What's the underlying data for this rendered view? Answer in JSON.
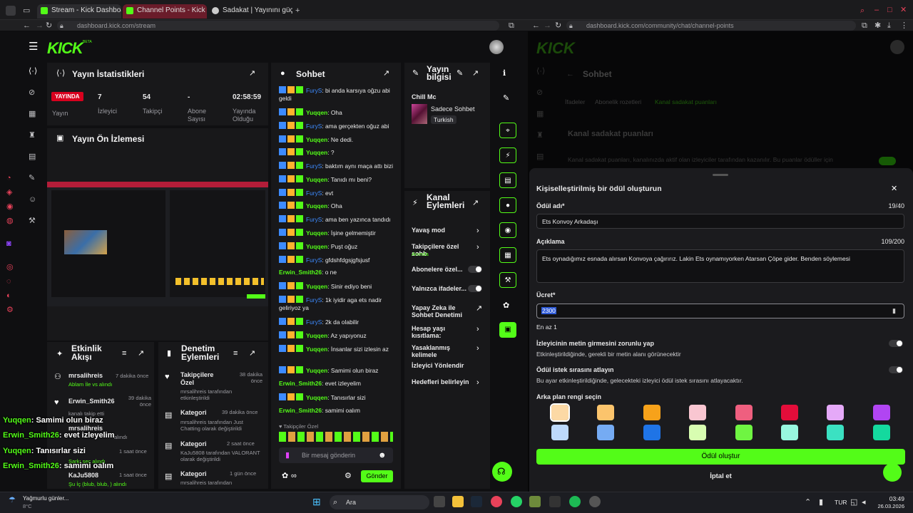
{
  "browser": {
    "tabs": [
      "Stream - Kick Dashboard",
      "Channel Points - Kick Das",
      "Sadakat | Yayınını güçlend"
    ],
    "url_left": "dashboard.kick.com/stream",
    "url_right": "dashboard.kick.com/community/chat/channel-points"
  },
  "logo": "KICK",
  "logo_beta": "BETA",
  "stats": {
    "title": "Yayın İstatistikleri",
    "live_badge": "YAYINDA",
    "live_label": "Yayın",
    "viewers": "7",
    "viewers_label": "İzleyici",
    "followers": "54",
    "followers_label": "Takipçi",
    "subs": "-",
    "subs_label": "Abone Sayısı",
    "duration": "02:58:59",
    "duration_label": "Yayında Olduğu"
  },
  "preview": {
    "title": "Yayın Ön İzlemesi"
  },
  "activity": {
    "title": "Etkinlik Akışı",
    "items": [
      {
        "user": "mrsalihreis",
        "time": "7 dakika önce",
        "detail": "Ablam İle vs alındı"
      },
      {
        "user": "Erwin_Smith26",
        "time": "39 dakika önce",
        "detail": "kanalı takip etti"
      },
      {
        "user": "mrsalihreis",
        "time": "",
        "detail": "alındı"
      },
      {
        "user": "",
        "time": "1 saat önce",
        "detail": "Şarkı seç alındı"
      },
      {
        "user": "KaJu5808",
        "time": "1 saat önce",
        "detail": "Şu İç (blub, blub, ) alındı"
      }
    ]
  },
  "moderation": {
    "title": "Denetim Eylemleri",
    "items": [
      {
        "title": "Takipçilere Özel",
        "time": "38 dakika önce",
        "detail": "mrsalihreis tarafından etkinleştirildi"
      },
      {
        "title": "Kategori",
        "time": "39 dakika önce",
        "detail": "mrsalihreis tarafından Just Chatting olarak değiştirildi"
      },
      {
        "title": "Kategori",
        "time": "2 saat önce",
        "detail": "KaJu5808 tarafından VALORANT olarak değiştirildi"
      },
      {
        "title": "Kategori",
        "time": "1 gün önce",
        "detail": "mrsalihreis tarafından"
      }
    ]
  },
  "chat": {
    "title": "Sohbet",
    "messages": [
      {
        "user": "FuryS",
        "text": ": bi anda karsıya oğzu abi geldi",
        "cls": "user-blue",
        "badges": true
      },
      {
        "user": "Yuqqen",
        "text": ": Oha",
        "cls": "user-green",
        "badges": true
      },
      {
        "user": "FuryS",
        "text": ": ama gerçekten oğuz abi",
        "cls": "user-blue",
        "badges": true
      },
      {
        "user": "Yuqqen",
        "text": ": Ne dedi.",
        "cls": "user-green",
        "badges": true
      },
      {
        "user": "Yuqqen",
        "text": ": ?",
        "cls": "user-green",
        "badges": true
      },
      {
        "user": "FuryS",
        "text": ": baktım aynı maça attı bizi",
        "cls": "user-blue",
        "badges": true
      },
      {
        "user": "Yuqqen",
        "text": ": Tanıdı mı beni?",
        "cls": "user-green",
        "badges": true
      },
      {
        "user": "FuryS",
        "text": ": evt",
        "cls": "user-blue",
        "badges": true
      },
      {
        "user": "Yuqqen",
        "text": ": Oha",
        "cls": "user-green",
        "badges": true
      },
      {
        "user": "FuryS",
        "text": ": ama ben yazınca tandıdı",
        "cls": "user-blue",
        "badges": true
      },
      {
        "user": "Yuqqen",
        "text": ": İşine gelmemiştir",
        "cls": "user-green",
        "badges": true
      },
      {
        "user": "Yuqqen",
        "text": ": Puşt oğuz",
        "cls": "user-green",
        "badges": true
      },
      {
        "user": "FuryS",
        "text": ": gfdshfdgsjgfsjusf",
        "cls": "user-blue",
        "badges": true
      },
      {
        "user": "Erwin_Smith26",
        "text": ": o ne",
        "cls": "user-green",
        "badges": false
      },
      {
        "user": "Yuqqen",
        "text": ": Sinir ediyo beni",
        "cls": "user-green",
        "badges": true
      },
      {
        "user": "FuryS",
        "text": ": 1k iyidir aga ets nadir geliriyoz ya",
        "cls": "user-blue",
        "badges": true
      },
      {
        "user": "FuryS",
        "text": ": 2k da olabilir",
        "cls": "user-blue",
        "badges": true
      },
      {
        "user": "Yuqqen",
        "text": ": Az yapıyonuz",
        "cls": "user-green",
        "badges": true
      },
      {
        "user": "Yuqqen",
        "text": ": İnsanlar sizi izlesin az",
        "cls": "user-green",
        "badges": true
      },
      {
        "user": "Yuqqen",
        "text": ": Samimi olun biraz",
        "cls": "user-green",
        "badges": true
      },
      {
        "user": "Erwin_Smith26",
        "text": ": evet izleyelim",
        "cls": "user-green",
        "badges": false
      },
      {
        "user": "Yuqqen",
        "text": ": Tanısırlar sizi",
        "cls": "user-green",
        "badges": true
      },
      {
        "user": "Erwin_Smith26",
        "text": ": samimi oalım",
        "cls": "user-green",
        "badges": false
      }
    ],
    "followers_only": "Takipçiler Özel",
    "input_placeholder": "Bir mesaj gönderin",
    "send": "Gönder"
  },
  "stream_info": {
    "title": "Yayın bilgisi",
    "stream_title": "Chill Mc",
    "category": "Sadece Sohbet",
    "language": "Turkish"
  },
  "channel_actions": {
    "title": "Kanal Eylemleri",
    "items": [
      {
        "label": "Yavaş mod",
        "sub": "",
        "kind": "arrow"
      },
      {
        "label": "Takipçilere özel sohb",
        "sub": "Anında",
        "kind": "arrow"
      },
      {
        "label": "Abonelere özel...",
        "sub": "",
        "kind": "toggle"
      },
      {
        "label": "Yalnızca ifadeler...",
        "sub": "",
        "kind": "toggle"
      },
      {
        "label": "Yapay Zeka ile Sohbet Denetimi",
        "sub": "",
        "kind": "ext"
      },
      {
        "label": "Hesap yaşı kısıtlama:",
        "sub": "",
        "kind": "arrow"
      },
      {
        "label": "Yasaklanmış kelimele",
        "sub": "",
        "kind": "arrow"
      },
      {
        "label": "İzleyici Yönlendir",
        "sub": "",
        "kind": "none"
      },
      {
        "label": "Hedefleri belirleyin",
        "sub": "",
        "kind": "arrow"
      }
    ]
  },
  "right_page": {
    "title": "Sohbet",
    "tabs": [
      "İfadeler",
      "Abonelik rozetleri",
      "Kanal sadakat puanları"
    ],
    "section": "Kanal sadakat puanları",
    "desc": "Kanal sadakat puanları, kanalınızda aktif olan izleyiciler tarafından kazanılır. Bu puanlar ödüller için"
  },
  "modal": {
    "title": "Kişiselleştirilmiş bir ödül oluşturun",
    "name_label": "Ödül adı*",
    "name_count": "19/40",
    "name_value": "Ets Konvoy Arkadaşı",
    "desc_label": "Açıklama",
    "desc_count": "109/200",
    "desc_value": "Ets oynadığımız esnada alırsan Konvoya çağırırız. Lakin Ets oynamıyorken Atarsan Çöpe gider. Benden söylemesi",
    "cost_label": "Ücret*",
    "cost_value": "2300",
    "cost_hint": "En az 1",
    "opt1_title": "İzleyicinin metin girmesini zorunlu yap",
    "opt1_desc": "Etkinleştirildiğinde, gerekli bir metin alanı görünecektir",
    "opt2_title": "Ödül istek sırasını atlayın",
    "opt2_desc": "Bu ayar etkinleştirildiğinde, gelecekteki izleyici ödül istek sırasını atlayacaktır.",
    "color_label": "Arka plan rengi seçin",
    "colors_row1": [
      "#fcd9a5",
      "#fbc46c",
      "#f7a21a",
      "#f9c6d1",
      "#ef5f7f",
      "#e40d3a",
      "#e5a9f8",
      "#b145f2"
    ],
    "colors_row2": [
      "#bdd9fb",
      "#75abf3",
      "#1f74e6",
      "#d8fdb1",
      "#6ff542",
      "#98f7df",
      "#3be1c2",
      "#14d99e"
    ],
    "create": "Ödül oluştur",
    "cancel": "İptal et"
  },
  "overlay": [
    {
      "user": "Yuqqen",
      "text": ": Samimi olun biraz",
      "color": "#53fc18"
    },
    {
      "user": "Erwin_Smith26",
      "text": ": evet izleyelim",
      "color": "#53fc18"
    },
    {
      "user": "Yuqqen",
      "text": ": Tanısırlar sizi",
      "color": "#53fc18"
    },
    {
      "user": "Erwin_Smith26",
      "text": ": samimi oalım",
      "color": "#53fc18"
    }
  ],
  "taskbar": {
    "weather": "Yağmurlu günler...",
    "temp": "8°C",
    "search": "Ara",
    "lang": "TUR",
    "time": "03:49",
    "date": "26.03.2026"
  }
}
